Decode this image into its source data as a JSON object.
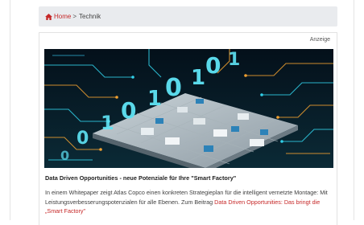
{
  "breadcrumb": {
    "home_label": "Home",
    "separator": ">",
    "current": "Technik"
  },
  "ad": {
    "label": "Anzeige"
  },
  "article": {
    "title": "Data Driven Opportunities - neue Potenziale für Ihre \"Smart Factory\"",
    "body_text": "In einem Whitepaper zeigt Atlas Copco einen konkreten Strategieplan für die intelligent vernetzte Montage: Mit Leistungsverbesserungspotenzialen für alle Ebenen. Zum Beitrag ",
    "link_text": "Data Driven Opportunities: Das bringt die „Smart Factory\"",
    "image_digits": [
      "0",
      "1",
      "0",
      "1",
      "0",
      "1",
      "0",
      "1",
      "0"
    ]
  },
  "colors": {
    "accent": "#c62828",
    "breadcrumb_bg": "#e9ebee",
    "image_cyan": "#31d0e8",
    "image_orange": "#f0a030"
  }
}
